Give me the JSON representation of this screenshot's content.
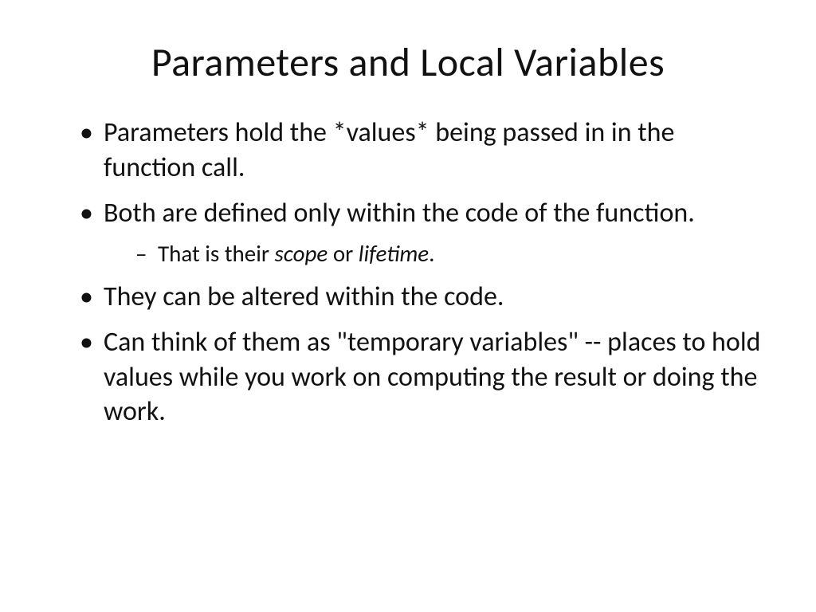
{
  "title": "Parameters and Local Variables",
  "bullets": {
    "b1": "Parameters hold the *values* being passed in in the function call.",
    "b2": "Both are defined only within the code of the function.",
    "b2_sub_pre": "That is their ",
    "b2_sub_ital1": "scope",
    "b2_sub_mid": " or ",
    "b2_sub_ital2": "lifetime",
    "b2_sub_post": ".",
    "b3": "They can be altered within the code.",
    "b4": "Can think of them as \"temporary variables\" -- places to hold values while you work on computing the result or doing the work."
  }
}
